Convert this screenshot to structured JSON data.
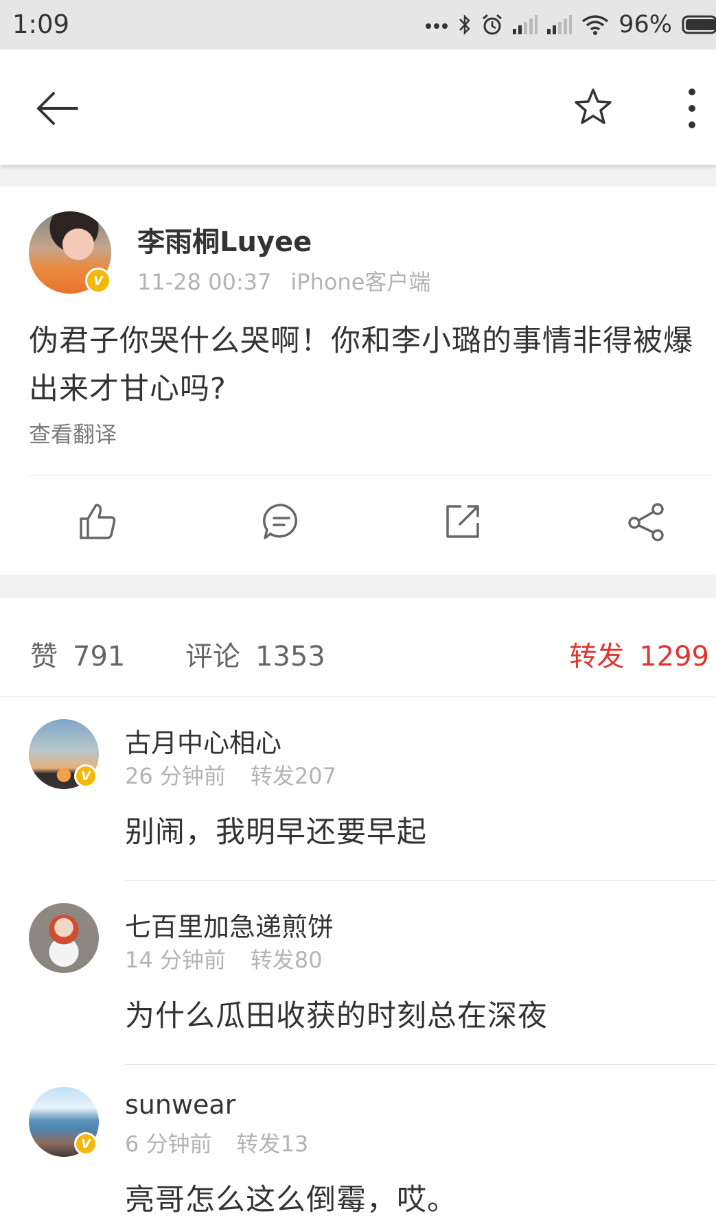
{
  "status_bar": {
    "time": "1:09",
    "battery_percent": "96%",
    "icons": [
      "dots-icon",
      "bluetooth-icon",
      "alarm-icon",
      "signal-icon",
      "signal-icon",
      "wifi-icon",
      "battery-icon"
    ]
  },
  "nav": {
    "icons": [
      "back-arrow-icon",
      "star-icon",
      "more-vertical-icon"
    ]
  },
  "post": {
    "author": "李雨桐Luyee",
    "verified": true,
    "time": "11-28 00:37",
    "source": "iPhone客户端",
    "text": "伪君子你哭什么哭啊！你和李小璐的事情非得被爆出来才甘心吗?",
    "translate_label": "查看翻译",
    "action_icons": [
      "like-icon",
      "comment-icon",
      "repost-icon",
      "share-icon"
    ]
  },
  "stats": {
    "likes_label": "赞",
    "likes_count": "791",
    "comments_label": "评论",
    "comments_count": "1353",
    "reposts_label": "转发",
    "reposts_count": "1299",
    "active_color": "#e0352f"
  },
  "comments": [
    {
      "name": "古月中心相心",
      "verified": true,
      "time": "26 分钟前",
      "reposts": "转发207",
      "text": "别闹，我明早还要早起"
    },
    {
      "name": "七百里加急递煎饼",
      "verified": false,
      "time": "14 分钟前",
      "reposts": "转发80",
      "text": "为什么瓜田收获的时刻总在深夜"
    },
    {
      "name": "sunwear",
      "verified": true,
      "time": "6 分钟前",
      "reposts": "转发13",
      "text": "亮哥怎么这么倒霉，哎。"
    }
  ],
  "colors": {
    "verified_badge": "#f5b80a",
    "accent_red": "#e0352f",
    "meta_gray": "#b3b3b3"
  }
}
